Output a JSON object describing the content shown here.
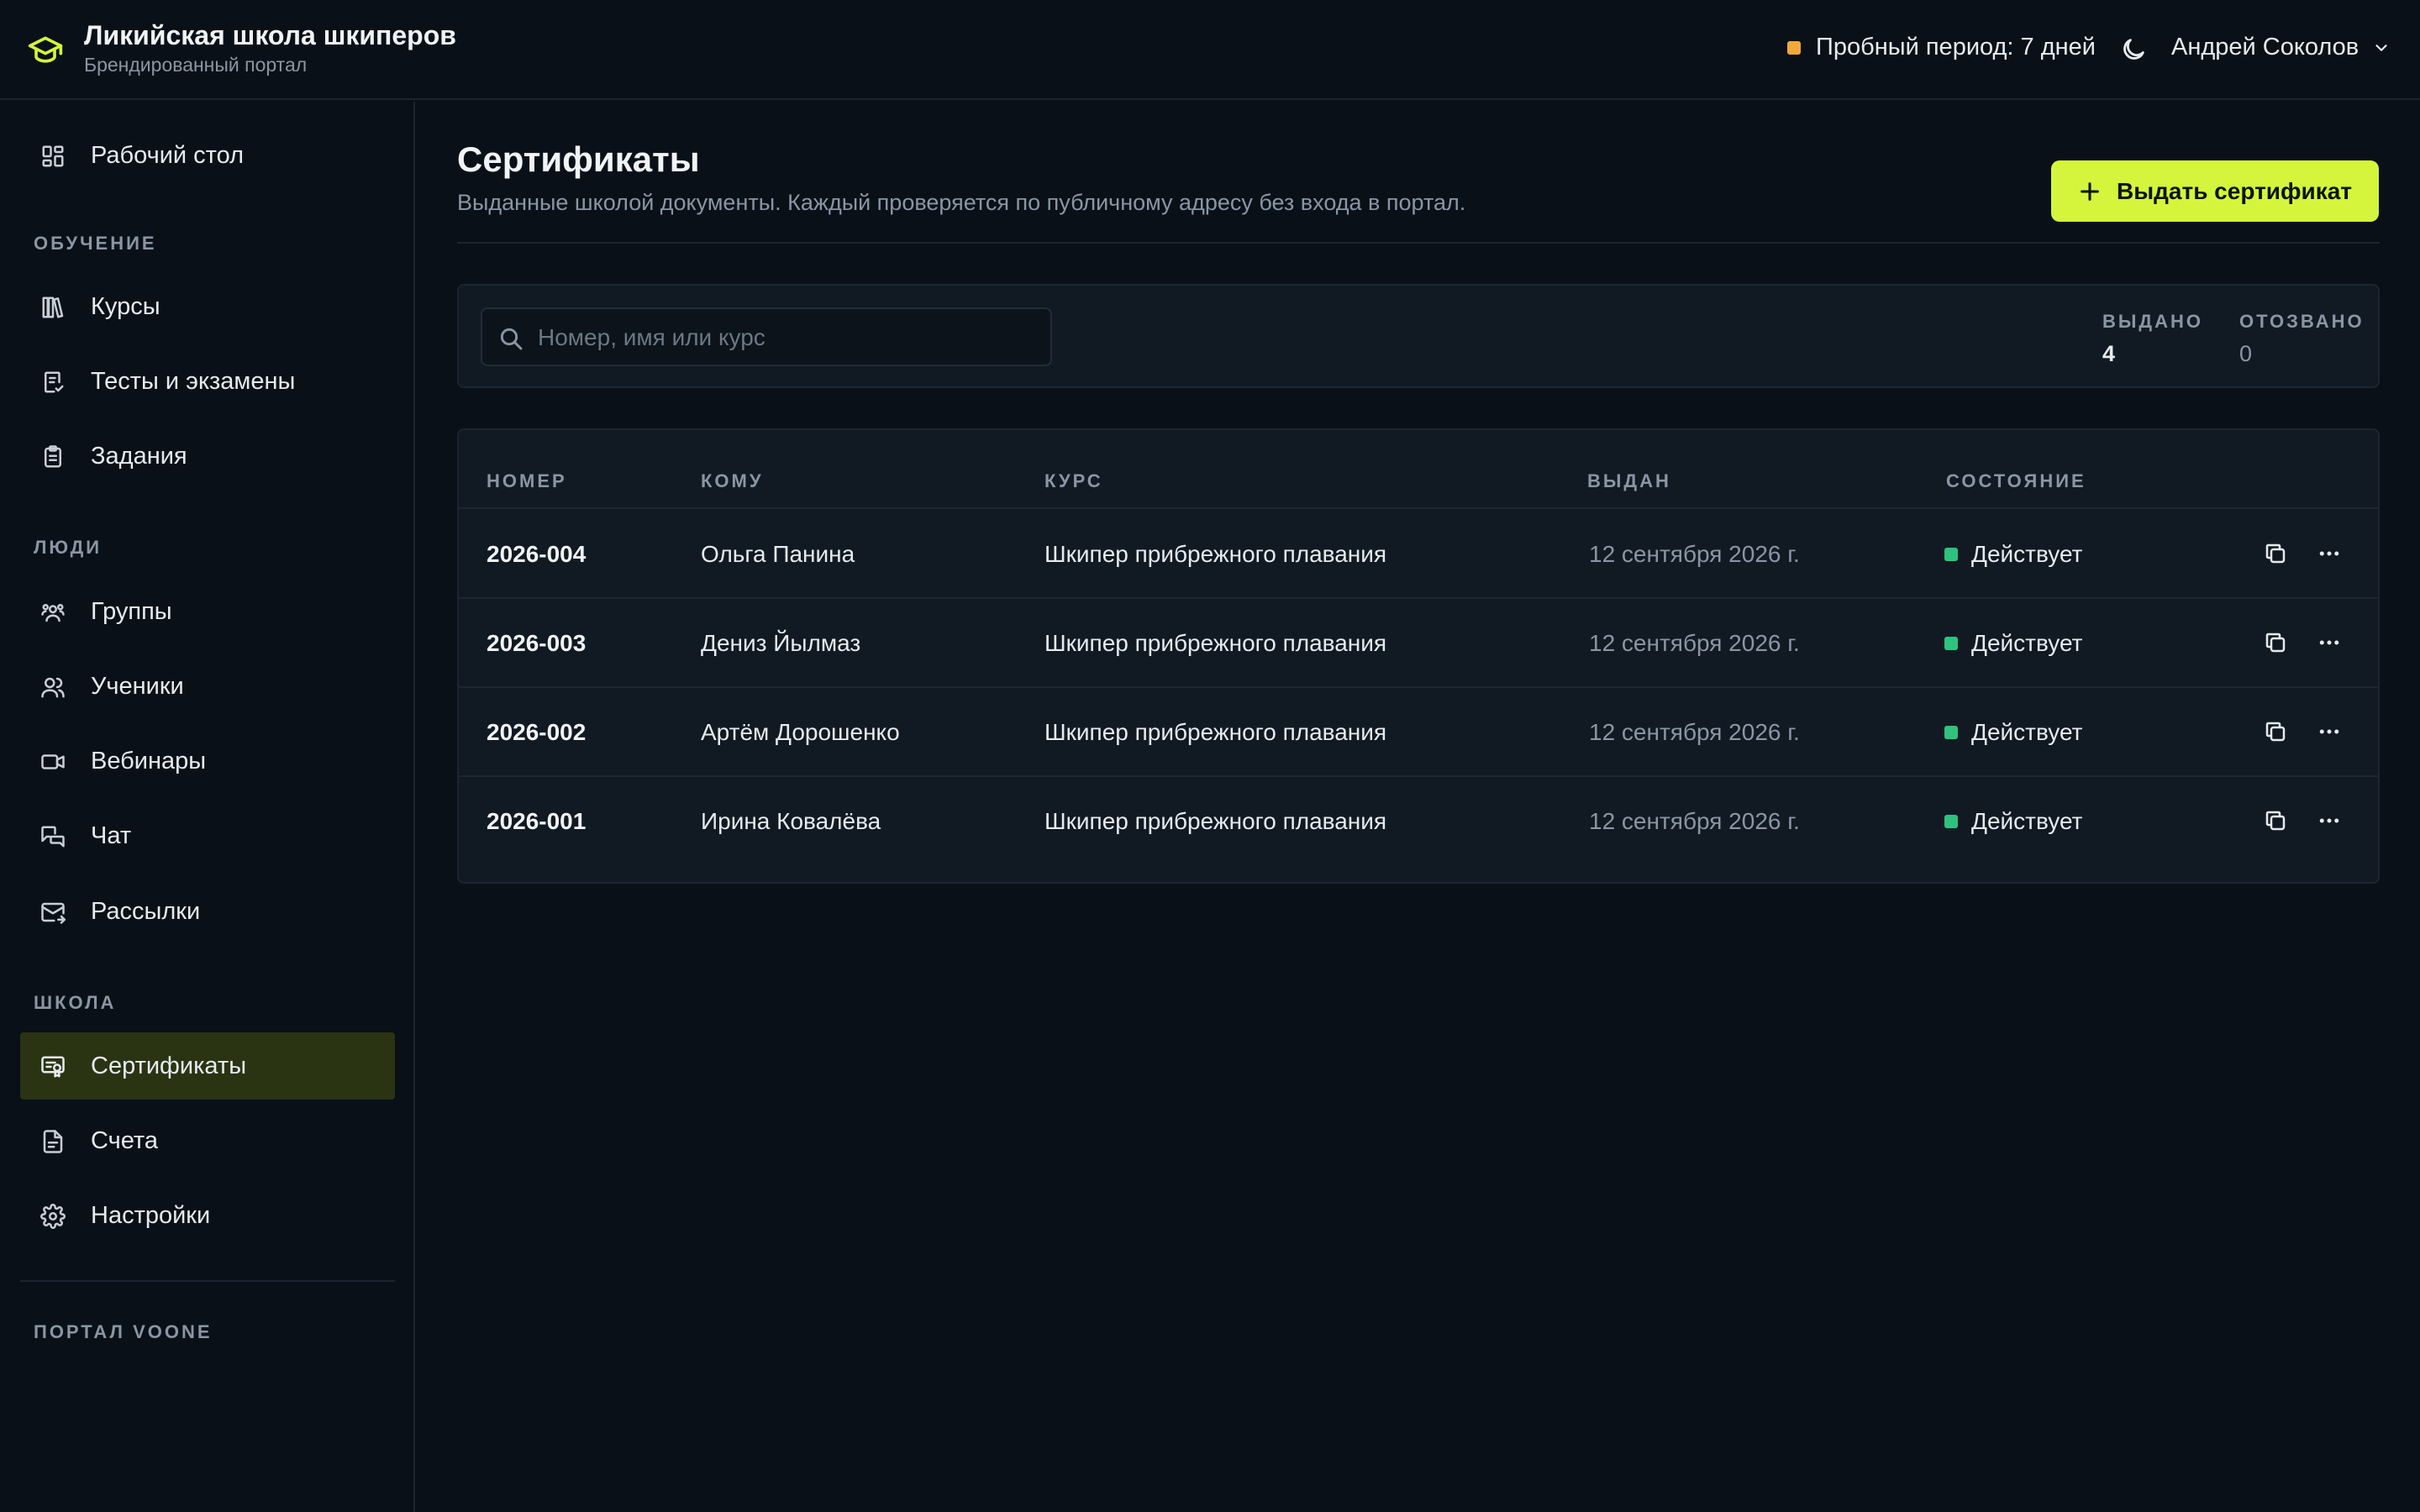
{
  "brand": {
    "title": "Ликийская школа шкиперов",
    "subtitle": "Брендированный портал",
    "icon": "graduation-cap-icon",
    "accent": "#d4f53c"
  },
  "header": {
    "trial_label": "Пробный период: 7 дней",
    "trial_color": "#f0a93b",
    "theme_icon": "moon-icon",
    "user_name": "Андрей Соколов"
  },
  "sidebar": {
    "dashboard": "Рабочий стол",
    "section_learning": "ОБУЧЕНИЕ",
    "courses": "Курсы",
    "tests": "Тесты и экзамены",
    "assignments": "Задания",
    "section_people": "ЛЮДИ",
    "groups": "Группы",
    "students": "Ученики",
    "webinars": "Вебинары",
    "chat": "Чат",
    "mailings": "Рассылки",
    "section_school": "ШКОЛА",
    "certificates": "Сертификаты",
    "invoices": "Счета",
    "settings": "Настройки",
    "section_portal": "ПОРТАЛ VOONE",
    "active_item": "certificates"
  },
  "page": {
    "title": "Сертификаты",
    "subtitle": "Выданные школой документы. Каждый проверяется по публичному адресу без входа в портал.",
    "issue_button": "Выдать сертификат"
  },
  "filters": {
    "search_placeholder": "Номер, имя или курс",
    "search_value": "",
    "issued_label": "ВЫДАНО",
    "issued_count": "4",
    "revoked_label": "ОТОЗВАНО",
    "revoked_count": "0"
  },
  "table": {
    "columns": {
      "number": "НОМЕР",
      "recipient": "КОМУ",
      "course": "КУРС",
      "issued": "ВЫДАН",
      "state": "СОСТОЯНИЕ"
    },
    "rows": [
      {
        "number": "2026-004",
        "recipient": "Ольга Панина",
        "course": "Шкипер прибрежного плавания",
        "issued": "12 сентября 2026 г.",
        "state": "Действует"
      },
      {
        "number": "2026-003",
        "recipient": "Дениз Йылмаз",
        "course": "Шкипер прибрежного плавания",
        "issued": "12 сентября 2026 г.",
        "state": "Действует"
      },
      {
        "number": "2026-002",
        "recipient": "Артём Дорошенко",
        "course": "Шкипер прибрежного плавания",
        "issued": "12 сентября 2026 г.",
        "state": "Действует"
      },
      {
        "number": "2026-001",
        "recipient": "Ирина Ковалёва",
        "course": "Шкипер прибрежного плавания",
        "issued": "12 сентября 2026 г.",
        "state": "Действует"
      }
    ],
    "status_color": "#2ec27e"
  }
}
